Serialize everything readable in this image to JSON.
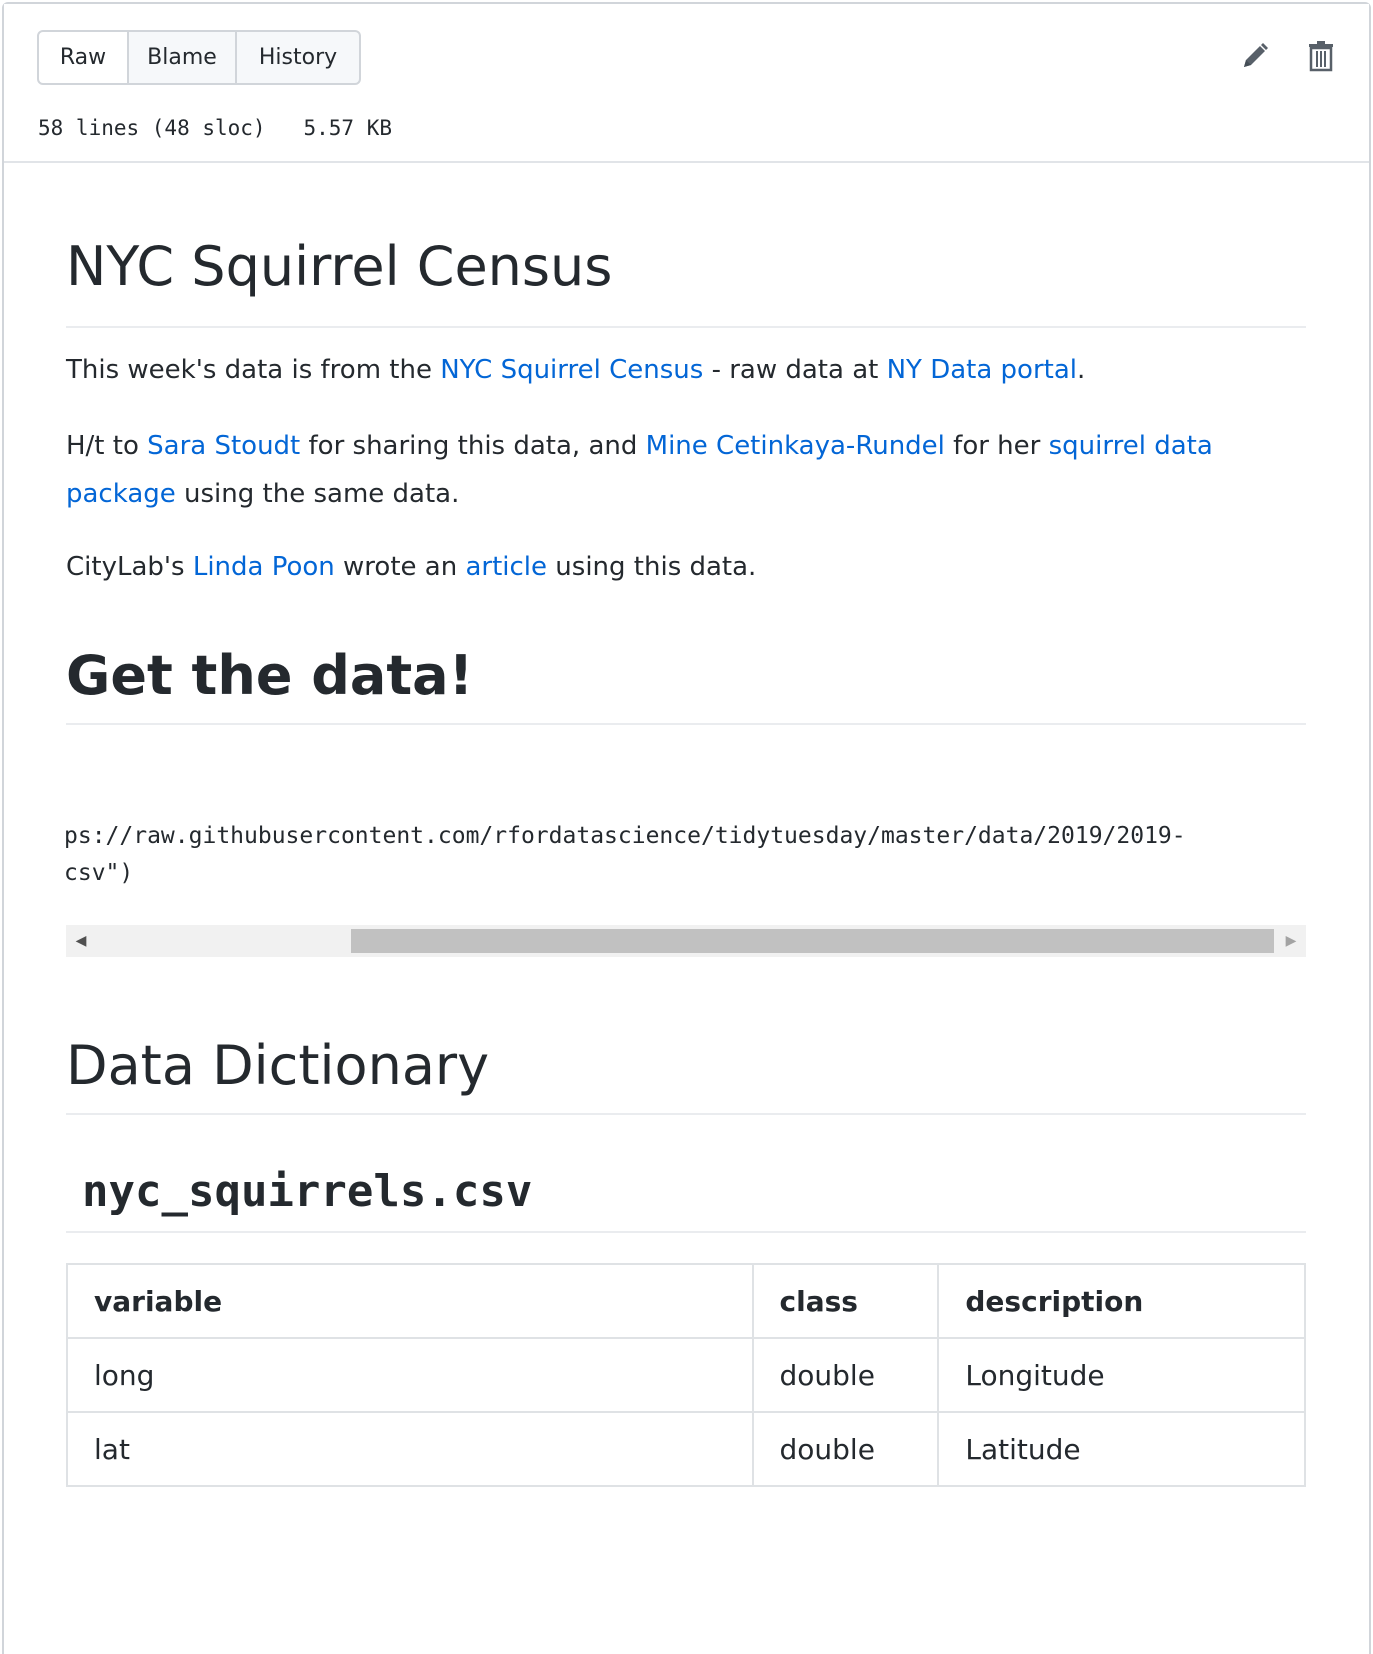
{
  "file_header": {
    "buttons": {
      "raw": "Raw",
      "blame": "Blame",
      "history": "History"
    },
    "file_info": "58 lines (48 sloc)   5.57 KB",
    "icons": {
      "edit": "pencil-icon",
      "delete": "trash-icon"
    }
  },
  "readme": {
    "title": "NYC Squirrel Census",
    "p1": {
      "t1": "This week's data is from the ",
      "link1": "NYC Squirrel Census",
      "t2": " - raw data at ",
      "link2": "NY Data portal",
      "t3": "."
    },
    "p2": {
      "t1": "H/t to ",
      "link1": "Sara Stoudt",
      "t2": " for sharing this data, and ",
      "link2": "Mine Cetinkaya-Rundel",
      "t3": " for her ",
      "link3": "squirrel data package",
      "t4": " using the same data."
    },
    "p3": {
      "t1": "CityLab's ",
      "link1": "Linda Poon",
      "t2": " wrote an ",
      "link2": "article",
      "t3": " using this data."
    },
    "get_data_heading": "Get the data!",
    "code_lines": [
      "ps://raw.githubusercontent.com/rfordatascience/tidytuesday/master/data/2019/2019-",
      "csv\")"
    ],
    "dictionary_heading": "Data Dictionary",
    "file_heading": "nyc_squirrels.csv",
    "table": {
      "headers": [
        "variable",
        "class",
        "description"
      ],
      "rows": [
        [
          "long",
          "double",
          "Longitude"
        ],
        [
          "lat",
          "double",
          "Latitude"
        ]
      ]
    }
  }
}
